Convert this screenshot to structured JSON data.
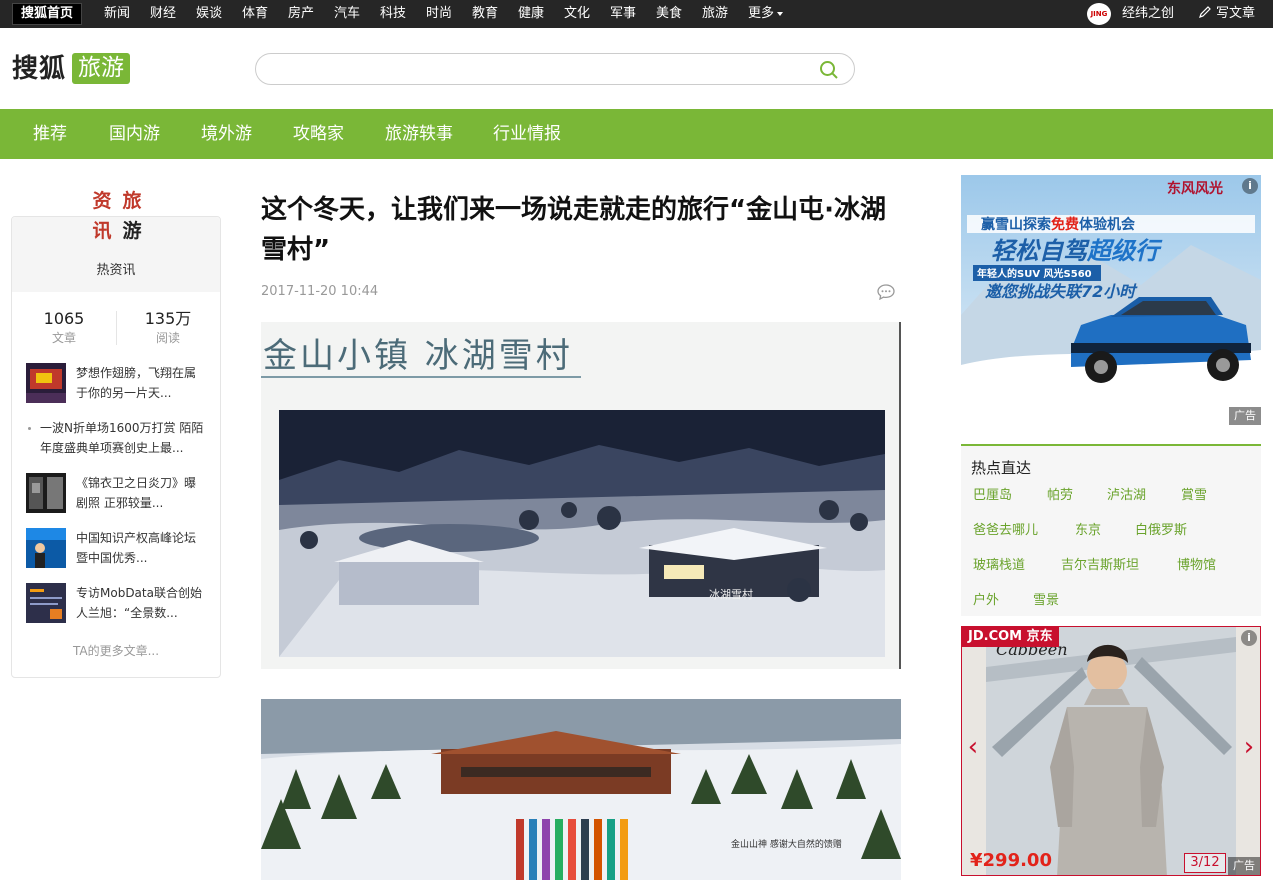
{
  "topbar": {
    "home": "搜狐首页",
    "channels": [
      "新闻",
      "财经",
      "娱谈",
      "体育",
      "房产",
      "汽车",
      "科技",
      "时尚",
      "教育",
      "健康",
      "文化",
      "军事",
      "美食",
      "旅游"
    ],
    "more": "更多",
    "jing_badge": "JING",
    "user_name": "经纬之创",
    "write": "写文章"
  },
  "brand": {
    "logo": "搜狐",
    "section": "旅游"
  },
  "search": {
    "placeholder": "",
    "value": ""
  },
  "nav": {
    "items": [
      "推荐",
      "国内游",
      "境外游",
      "攻略家",
      "旅游轶事",
      "行业情报"
    ]
  },
  "profile": {
    "avatar_chars": [
      "资",
      "旅",
      "讯",
      "游"
    ],
    "name": "热资讯",
    "stats": [
      {
        "value": "1065",
        "label": "文章"
      },
      {
        "value": "135万",
        "label": "阅读"
      }
    ],
    "articles": [
      {
        "text": "梦想作翅膀，飞翔在属于你的另一片天...",
        "has_thumb": true
      },
      {
        "text": "一波N折单场1600万打赏 陌陌年度盛典单项赛创史上最...",
        "has_thumb": false
      },
      {
        "text": "《锦衣卫之日炎刀》曝剧照 正邪较量...",
        "has_thumb": true
      },
      {
        "text": "中国知识产权高峰论坛暨中国优秀...",
        "has_thumb": true
      },
      {
        "text": "专访MobData联合创始人兰旭：“全景数...",
        "has_thumb": true
      }
    ],
    "more": "TA的更多文章..."
  },
  "article": {
    "title": "这个冬天，让我们来一场说走就走的旅行“金山屯·冰湖雪村”",
    "date": "2017-11-20 10:44",
    "image1_caption": "金山小镇 冰湖雪村",
    "image1_sign": "冰湖雪村",
    "image2_caption": "金山山神  感谢大自然的馈赠"
  },
  "ad_top": {
    "brand": "东风风光",
    "line1_a": "赢雪山探索",
    "line1_b": "免费",
    "line1_c": "体验机会",
    "line2_a": "轻松自驾",
    "line2_b": "超级行",
    "line3_a": "年轻人的SUV 风光S560",
    "line4": "邀您挑战失联72小时",
    "tag": "广告"
  },
  "hot": {
    "title": "热点直达",
    "tags": [
      "巴厘岛",
      "帕劳",
      "泸沽湖",
      "賞雪",
      "爸爸去哪儿",
      "东京",
      "白俄罗斯",
      "玻璃栈道",
      "吉尔吉斯斯坦",
      "博物馆",
      "户外",
      "雪景"
    ]
  },
  "ad_jd": {
    "jd": "JD.COM 京东",
    "brand_text": "Cabbeen",
    "price": "¥299.00",
    "pager": "3/12",
    "tag": "广告"
  },
  "colors": {
    "green": "#7ab737",
    "topbar": "#262626",
    "jd_red": "#c8102e"
  }
}
